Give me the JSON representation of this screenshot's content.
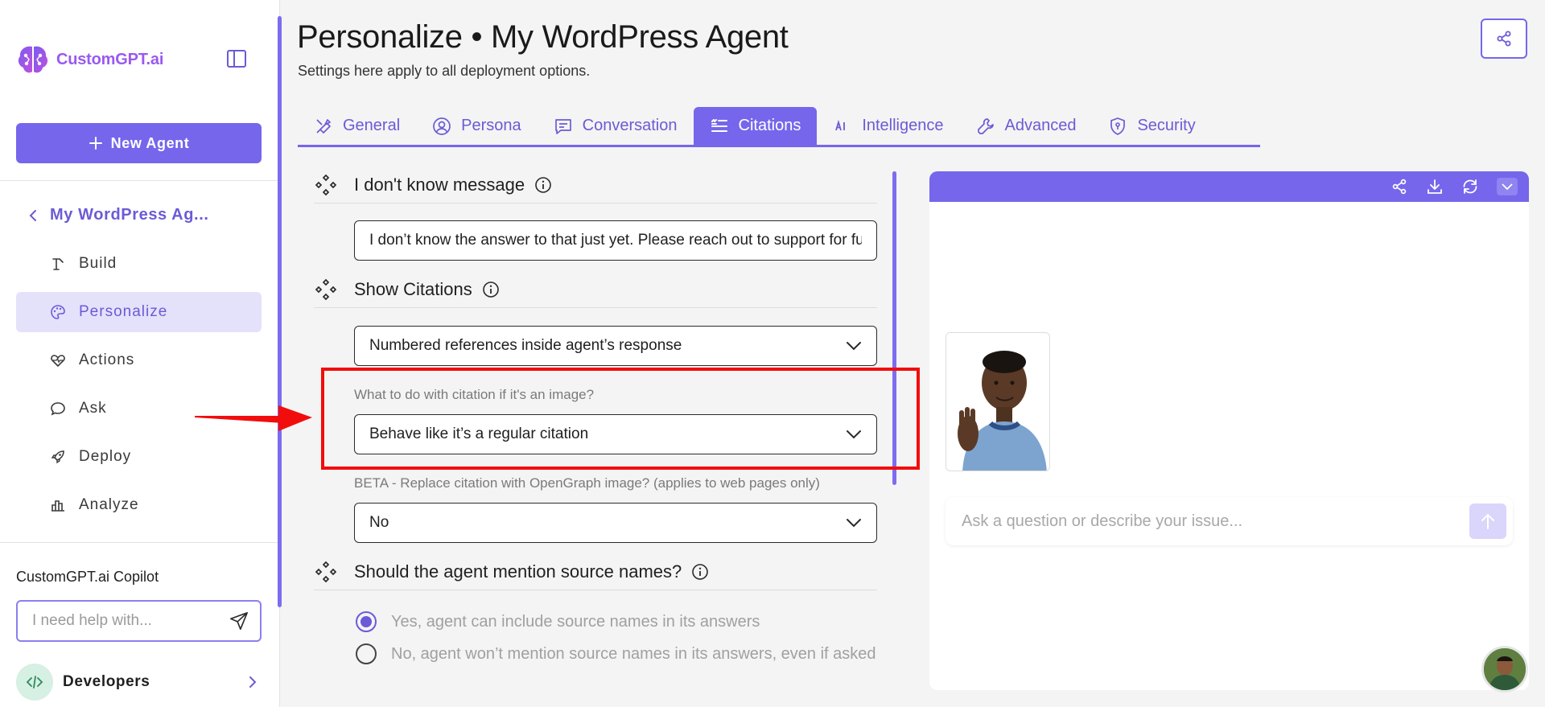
{
  "brand": {
    "name": "CustomGPT.ai",
    "accent": "#7566ec",
    "logo_color": "#9a59f0"
  },
  "sidebar": {
    "new_agent_label": "New Agent",
    "agent_name": "My WordPress Ag...",
    "items": [
      {
        "label": "Build",
        "icon": "build-icon"
      },
      {
        "label": "Personalize",
        "icon": "palette-icon",
        "active": true
      },
      {
        "label": "Actions",
        "icon": "heart-pulse-icon"
      },
      {
        "label": "Ask",
        "icon": "chat-bubble-icon"
      },
      {
        "label": "Deploy",
        "icon": "rocket-icon"
      },
      {
        "label": "Analyze",
        "icon": "bar-chart-icon"
      }
    ],
    "copilot_title": "CustomGPT.ai Copilot",
    "copilot_placeholder": "I need help with...",
    "developers_label": "Developers"
  },
  "header": {
    "title": "Personalize • My WordPress Agent",
    "subtitle": "Settings here apply to all deployment options."
  },
  "tabs": [
    {
      "label": "General",
      "icon": "paint-tools-icon"
    },
    {
      "label": "Persona",
      "icon": "user-circle-icon"
    },
    {
      "label": "Conversation",
      "icon": "message-icon"
    },
    {
      "label": "Citations",
      "icon": "quote-list-icon",
      "active": true
    },
    {
      "label": "Intelligence",
      "icon": "ai-icon"
    },
    {
      "label": "Advanced",
      "icon": "wrench-icon"
    },
    {
      "label": "Security",
      "icon": "shield-icon"
    }
  ],
  "form": {
    "idk_title": "I don't know message",
    "idk_value": "I don’t know the answer to that just yet. Please reach out to support for further help.",
    "show_citations_title": "Show Citations",
    "show_citations_value": "Numbered references inside agent’s response",
    "image_citation_label": "What to do with citation if it's an image?",
    "image_citation_value": "Behave like it’s a regular citation",
    "opengraph_label": "BETA - Replace citation with OpenGraph image? (applies to web pages only)",
    "opengraph_value": "No",
    "source_names_title": "Should the agent mention source names?",
    "source_names_options": [
      {
        "label": "Yes, agent can include source names in its answers",
        "checked": true
      },
      {
        "label": "No, agent won’t mention source names in its answers, even if asked",
        "checked": false
      }
    ]
  },
  "preview": {
    "ask_placeholder": "Ask a question or describe your issue..."
  },
  "annotation": {
    "color": "#f20d0d"
  }
}
